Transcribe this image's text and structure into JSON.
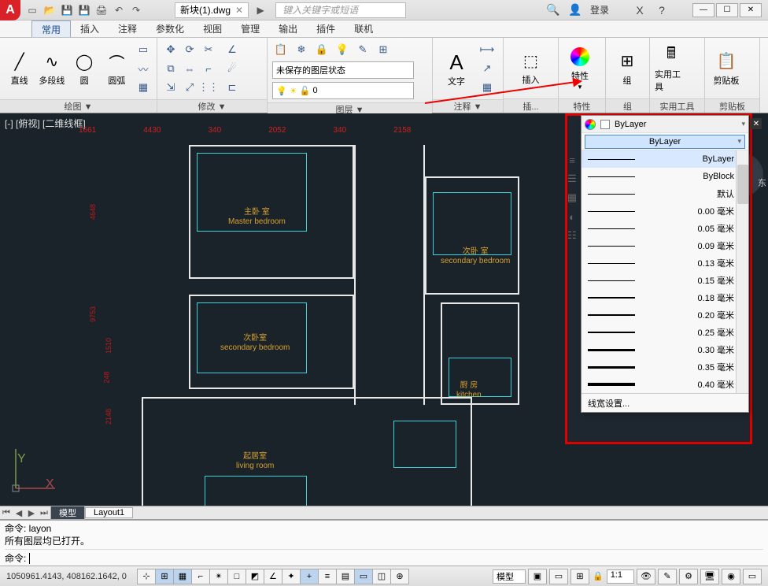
{
  "app": {
    "icon_letter": "A",
    "doc_title": "新块(1).dwg",
    "search_placeholder": "键入关键字或短语",
    "login_label": "登录"
  },
  "ribbon_tabs": [
    "常用",
    "插入",
    "注释",
    "参数化",
    "视图",
    "管理",
    "输出",
    "插件",
    "联机"
  ],
  "ribbon_active_tab": 0,
  "panels": {
    "draw": {
      "title": "绘图 ▼",
      "buttons": [
        "直线",
        "多段线",
        "圆",
        "圆弧"
      ]
    },
    "modify": {
      "title": "修改 ▼"
    },
    "layer": {
      "title": "图层 ▼",
      "state_label": "未保存的图层状态",
      "current_layer": "0"
    },
    "annotate": {
      "title": "注释 ▼",
      "text_label": "文字"
    },
    "insert": {
      "title": "插...",
      "label": "插入"
    },
    "props": {
      "title": "特性",
      "label": "特性"
    },
    "group": {
      "title": "组",
      "label": "组"
    },
    "utilities": {
      "title": "实用工具",
      "label": "实用工具"
    },
    "clipboard": {
      "title": "剪贴板",
      "label": "剪贴板"
    }
  },
  "viewport_label": "[-] [俯视] [二维线框]",
  "dims_top": [
    "1661",
    "4430",
    "340",
    "2052",
    "340",
    "2158"
  ],
  "dims_left": [
    "4648",
    "9753",
    "1510",
    "248",
    "2148"
  ],
  "rooms": {
    "master": {
      "cn": "主卧 室",
      "en": "Master bedroom"
    },
    "secondary1": {
      "cn": "次卧室",
      "en": "secondary bedroom"
    },
    "secondary2": {
      "cn": "次卧 室",
      "en": "secondary bedroom"
    },
    "kitchen": {
      "cn": "厨 房",
      "en": "kitchen"
    },
    "living": {
      "cn": "起居室",
      "en": "living room"
    }
  },
  "compass_east": "东",
  "prop_panel": {
    "color_label": "ByLayer",
    "linetype_label": "ByLayer",
    "lineweight_selected": "ByLayer",
    "items": [
      "ByLayer",
      "ByBlock",
      "默认",
      "0.00 毫米",
      "0.05 毫米",
      "0.09 毫米",
      "0.13 毫米",
      "0.15 毫米",
      "0.18 毫米",
      "0.20 毫米",
      "0.25 毫米",
      "0.30 毫米",
      "0.35 毫米",
      "0.40 毫米"
    ],
    "settings_label": "线宽设置..."
  },
  "model_tabs": [
    "模型",
    "Layout1"
  ],
  "cmd": {
    "line1": "命令:   layon",
    "line2": "所有图层均已打开。",
    "prompt": "命令:"
  },
  "status": {
    "coords": "1050961.4143, 408162.1642, 0",
    "model_label": "模型",
    "scale": "1:1",
    "ann_scale": "1:1"
  }
}
